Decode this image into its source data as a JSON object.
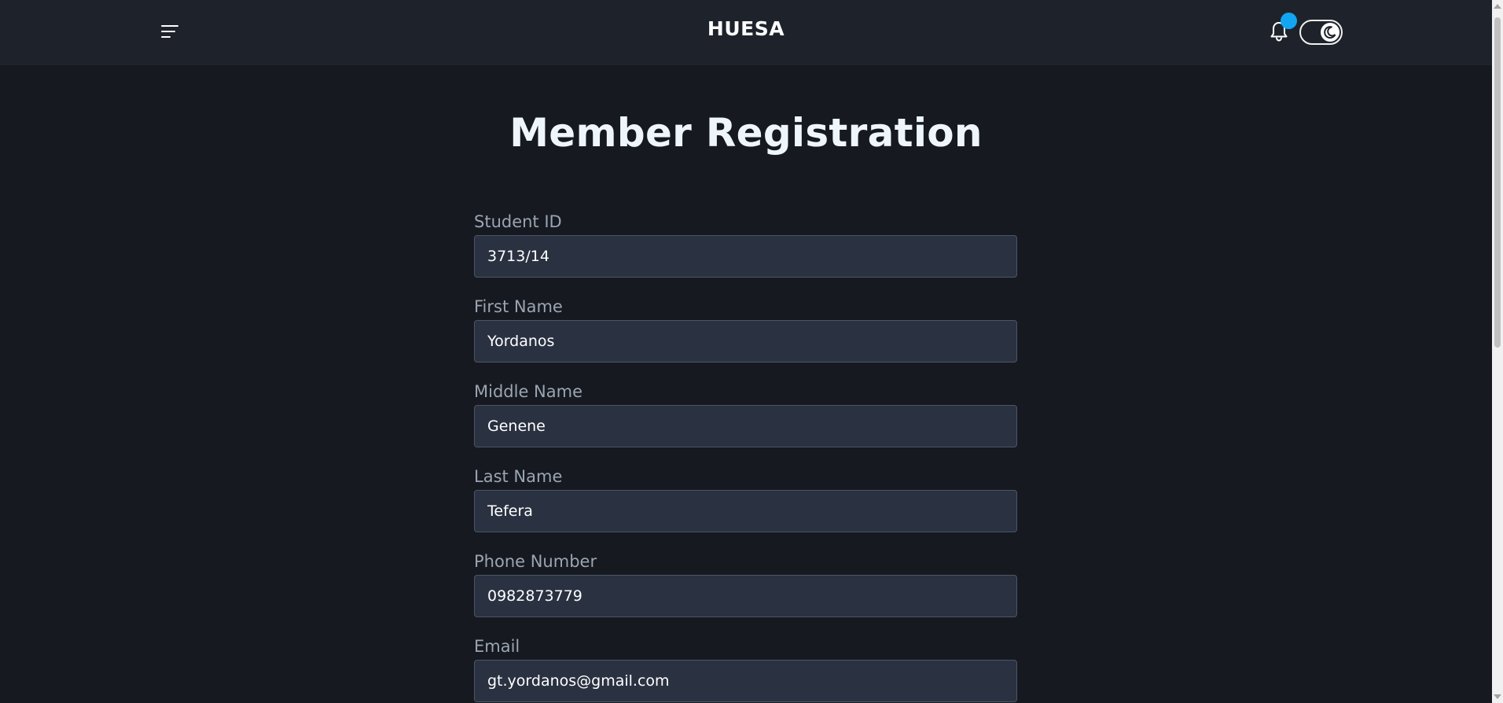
{
  "header": {
    "brand": "HUESA",
    "menu_icon": "hamburger-menu-icon",
    "notification_icon": "bell-icon",
    "theme_toggle_icon": "moon-icon",
    "accent_color": "#12a6f2"
  },
  "main": {
    "title": "Member Registration",
    "fields": [
      {
        "label": "Student ID",
        "value": "3713/14"
      },
      {
        "label": "First Name",
        "value": "Yordanos"
      },
      {
        "label": "Middle Name",
        "value": "Genene"
      },
      {
        "label": "Last Name",
        "value": "Tefera"
      },
      {
        "label": "Phone Number",
        "value": "0982873779"
      },
      {
        "label": "Email",
        "value": "gt.yordanos@gmail.com"
      }
    ]
  }
}
